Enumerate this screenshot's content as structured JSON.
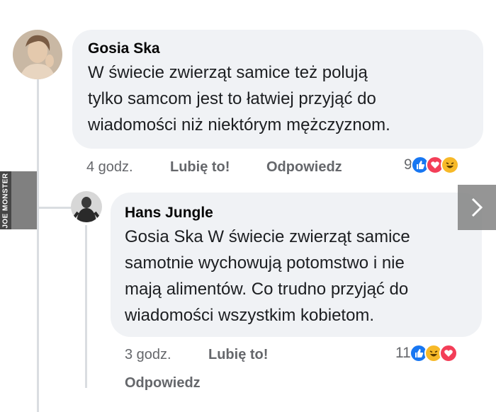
{
  "comment": {
    "author": "Gosia Ska",
    "lines": [
      "W świecie zwierząt samice też polują",
      "tylko samcom jest to łatwiej przyjąć do",
      "wiadomości niż niektórym mężczyznom."
    ],
    "time": "4 godz.",
    "like_label": "Lubię to!",
    "reply_label": "Odpowiedz",
    "reaction_count": "9",
    "reactions": [
      "like-icon",
      "love-icon",
      "haha-icon"
    ]
  },
  "reply": {
    "author": "Hans Jungle",
    "lines": [
      "Gosia Ska W świecie zwierząt samice",
      "samotnie wychowują potomstwo i nie",
      "mają alimentów. Co trudno przyjąć do",
      "wiadomości wszystkim kobietom."
    ],
    "time": "3 godz.",
    "like_label": "Lubię to!",
    "reply_label": "Odpowiedz",
    "reaction_count": "11",
    "reactions": [
      "like-icon",
      "haha-icon",
      "love-icon"
    ]
  },
  "watermark": {
    "text": "JOE MONSTER"
  },
  "colors": {
    "bubble": "#f0f2f5",
    "meta": "#65676b",
    "like": "#1877f2",
    "love": "#f33e58",
    "haha": "#f7b928"
  }
}
